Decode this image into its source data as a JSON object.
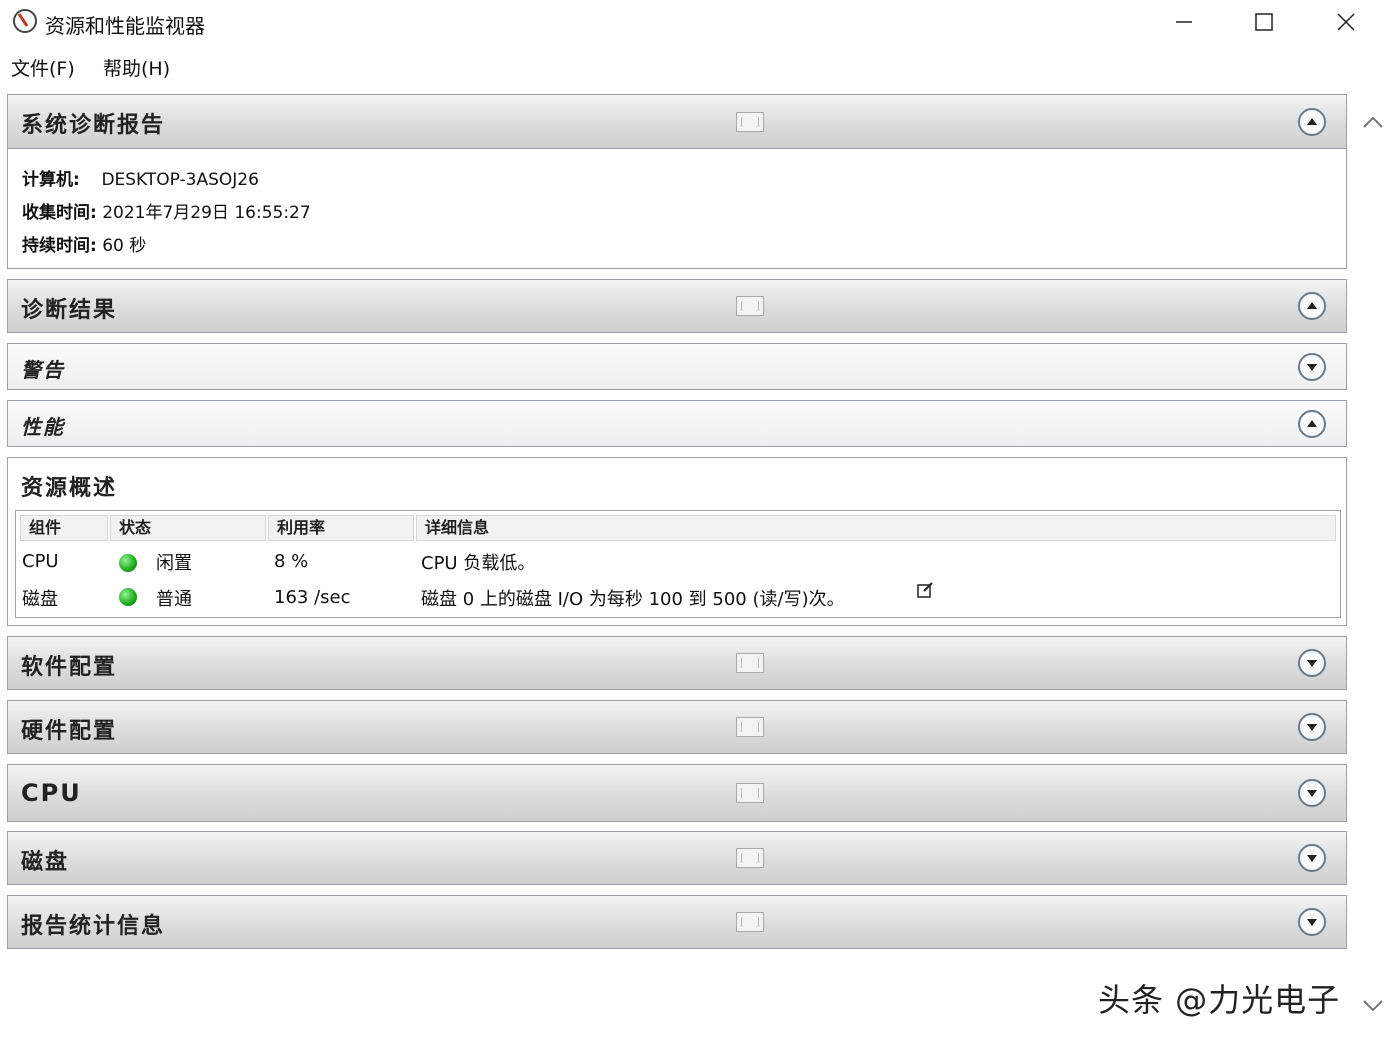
{
  "window": {
    "title": "资源和性能监视器",
    "controls": [
      "minimize",
      "maximize",
      "close"
    ]
  },
  "menu": [
    {
      "label": "文件(F)"
    },
    {
      "label": "帮助(H)"
    }
  ],
  "report": {
    "title": "系统诊断报告",
    "computer_label": "计算机:",
    "computer_value": "DESKTOP-3ASOJ26",
    "collected_label": "收集时间:",
    "collected_value": "2021年7月29日  16:55:27",
    "duration_label": "持续时间:",
    "duration_value": "60 秒"
  },
  "sections": {
    "diagnosis": "诊断结果",
    "warning": "警告",
    "performance": "性能",
    "resource_overview": "资源概述",
    "software": "软件配置",
    "hardware": "硬件配置",
    "cpu": "CPU",
    "disk": "磁盘",
    "stats": "报告统计信息"
  },
  "resource_table": {
    "headers": [
      "组件",
      "状态",
      "利用率",
      "详细信息"
    ],
    "rows": [
      {
        "component": "CPU",
        "status": "闲置",
        "usage": "8 %",
        "detail": "CPU 负载低。",
        "status_color": "#1ea81e"
      },
      {
        "component": "磁盘",
        "status": "普通",
        "usage": "163 /sec",
        "detail": "磁盘 0 上的磁盘 I/O 为每秒 100 到 500 (读/写)次。",
        "status_color": "#1ea81e"
      }
    ]
  },
  "watermark": "头条 @力光电子"
}
